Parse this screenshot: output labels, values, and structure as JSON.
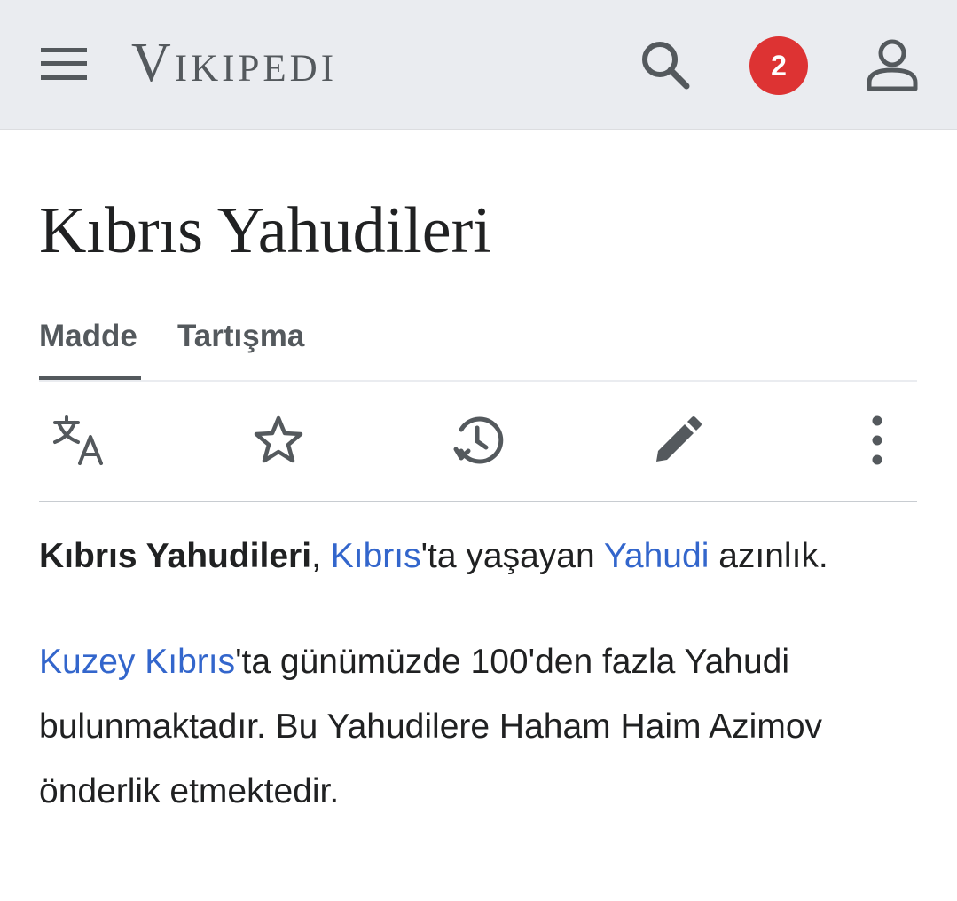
{
  "header": {
    "logo": "Vikipedi",
    "notifications_count": "2"
  },
  "article": {
    "title": "Kıbrıs Yahudileri"
  },
  "tabs": [
    {
      "label": "Madde",
      "active": true
    },
    {
      "label": "Tartışma",
      "active": false
    }
  ],
  "actions": [
    "language-icon",
    "watch-star-icon",
    "history-icon",
    "edit-pencil-icon",
    "more-vertical-icon"
  ],
  "content": {
    "p1": {
      "bold": "Kıbrıs Yahudileri",
      "t1": ", ",
      "link1": "Kıbrıs",
      "t2": "'ta yaşayan ",
      "link2": "Yahudi",
      "t3": " azınlık."
    },
    "p2": {
      "link1": "Kuzey Kıbrıs",
      "t1": "'ta günümüzde 100'den fazla Yahudi bulunmaktadır. Bu Yahudilere Haham Haim Azimov önderlik etmektedir."
    }
  },
  "colors": {
    "header_bg": "#eaecf0",
    "link": "#3366cc",
    "badge": "#dd3333",
    "icon": "#54595d"
  }
}
